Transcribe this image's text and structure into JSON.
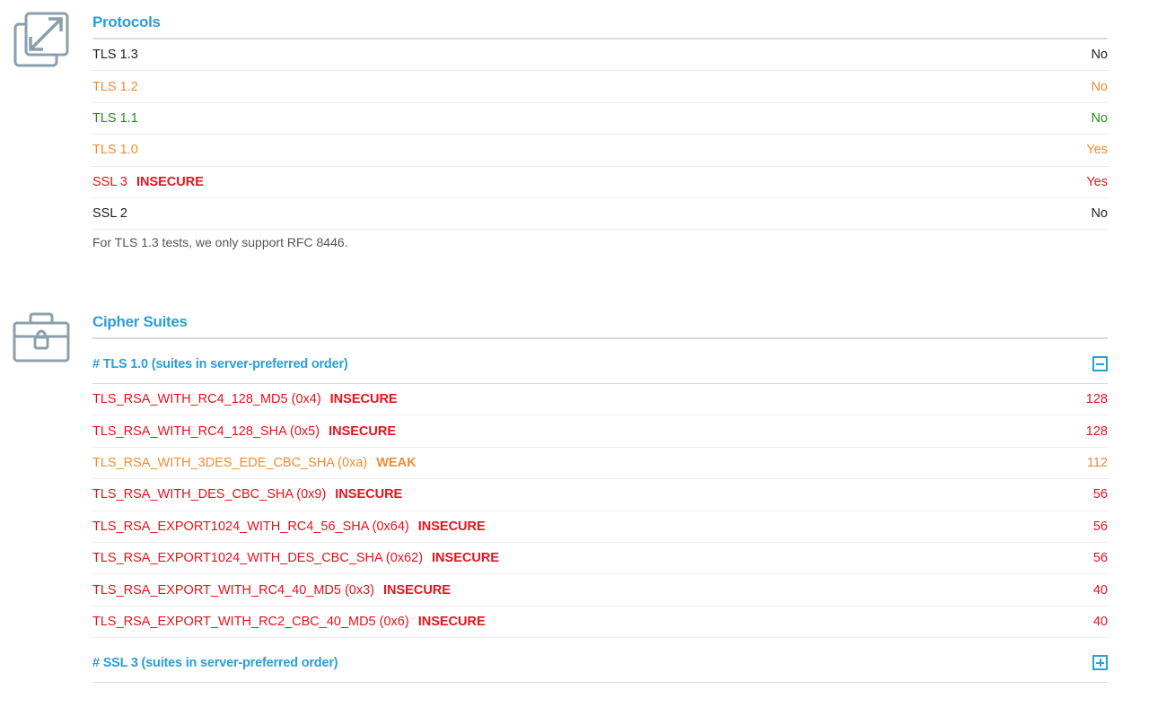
{
  "protocols": {
    "title": "Protocols",
    "rows": [
      {
        "name": "TLS 1.3",
        "badge": "",
        "value": "No",
        "color": "#222222"
      },
      {
        "name": "TLS 1.2",
        "badge": "",
        "value": "No",
        "color": "#f08c32"
      },
      {
        "name": "TLS 1.1",
        "badge": "",
        "value": "No",
        "color": "#2a8a1e"
      },
      {
        "name": "TLS 1.0",
        "badge": "",
        "value": "Yes",
        "color": "#f08c32"
      },
      {
        "name": "SSL 3",
        "badge": "INSECURE",
        "value": "Yes",
        "color": "#e8121c"
      },
      {
        "name": "SSL 2",
        "badge": "",
        "value": "No",
        "color": "#222222"
      }
    ],
    "note": "For TLS 1.3 tests, we only support RFC 8446."
  },
  "ciphers": {
    "title": "Cipher Suites",
    "groups": [
      {
        "label": "# TLS 1.0 (suites in server-preferred order)",
        "toggle_icon": "collapse-icon",
        "expanded": true,
        "suites": [
          {
            "name": "TLS_RSA_WITH_RC4_128_MD5 (0x4)",
            "badge": "INSECURE",
            "bits": "128",
            "color": "#e8121c"
          },
          {
            "name": "TLS_RSA_WITH_RC4_128_SHA (0x5)",
            "badge": "INSECURE",
            "bits": "128",
            "color": "#e8121c"
          },
          {
            "name": "TLS_RSA_WITH_3DES_EDE_CBC_SHA (0xa)",
            "badge": "WEAK",
            "bits": "112",
            "color": "#f08c32"
          },
          {
            "name": "TLS_RSA_WITH_DES_CBC_SHA (0x9)",
            "badge": "INSECURE",
            "bits": "56",
            "color": "#e8121c"
          },
          {
            "name": "TLS_RSA_EXPORT1024_WITH_RC4_56_SHA (0x64)",
            "badge": "INSECURE",
            "bits": "56",
            "color": "#e8121c"
          },
          {
            "name": "TLS_RSA_EXPORT1024_WITH_DES_CBC_SHA (0x62)",
            "badge": "INSECURE",
            "bits": "56",
            "color": "#e8121c"
          },
          {
            "name": "TLS_RSA_EXPORT_WITH_RC4_40_MD5 (0x3)",
            "badge": "INSECURE",
            "bits": "40",
            "color": "#e8121c"
          },
          {
            "name": "TLS_RSA_EXPORT_WITH_RC2_CBC_40_MD5 (0x6)",
            "badge": "INSECURE",
            "bits": "40",
            "color": "#e8121c"
          }
        ]
      },
      {
        "label": "# SSL 3 (suites in server-preferred order)",
        "toggle_icon": "expand-icon",
        "expanded": false,
        "suites": []
      }
    ]
  },
  "icons": {
    "protocols": "expand-arrows-icon",
    "ciphers": "locked-briefcase-icon"
  },
  "colors": {
    "accent": "#2a9fd6",
    "insecure": "#e8121c",
    "weak": "#f08c32",
    "ok": "#2a8a1e",
    "icon_gray": "#8aa0ac"
  }
}
